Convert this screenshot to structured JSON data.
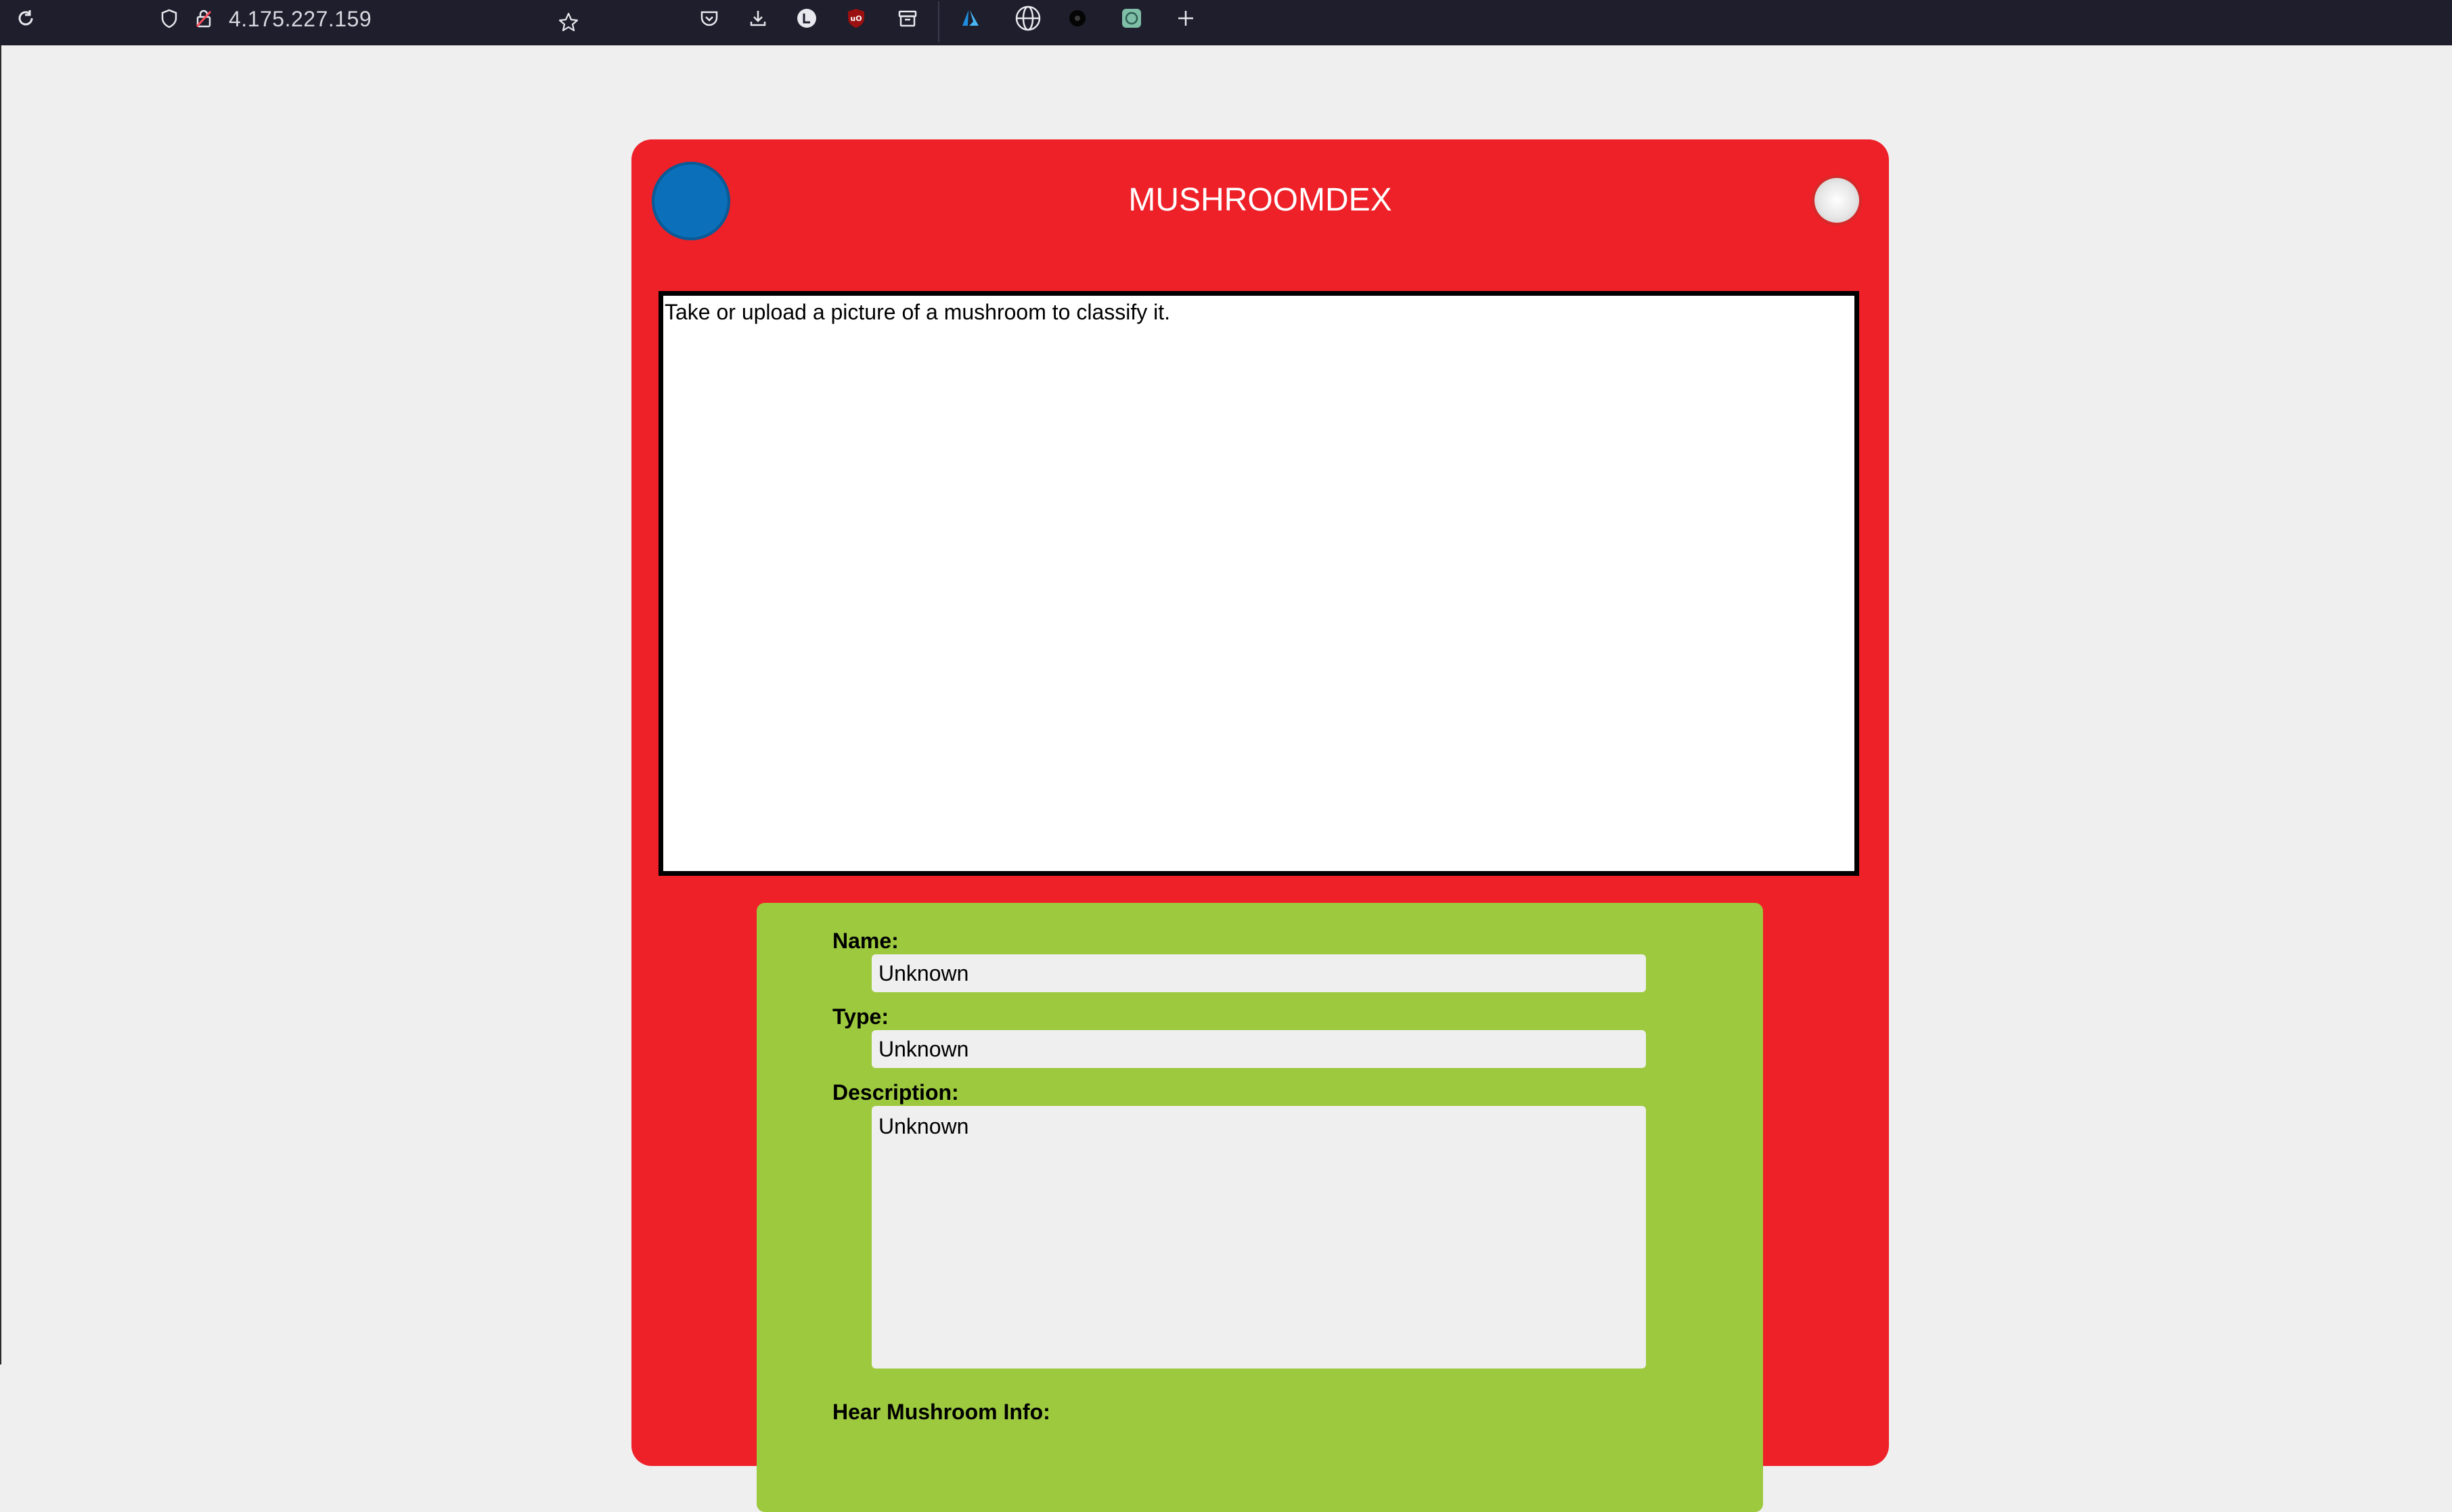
{
  "browser": {
    "url": "4.175.227.159",
    "icons": [
      "reload-icon",
      "shield-icon",
      "lock-icon",
      "star-icon",
      "pocket-icon",
      "download-icon",
      "extension-l-icon",
      "ublock-icon",
      "container-icon",
      "azure-icon",
      "globe-icon",
      "extension-dark-icon",
      "extension-green-icon",
      "new-tab-icon"
    ]
  },
  "app": {
    "title": "MUSHROOMDEX",
    "screen_prompt": "Take or upload a picture of a mushroom to classify it.",
    "fields": {
      "name_label": "Name:",
      "name_value": "Unknown",
      "type_label": "Type:",
      "type_value": "Unknown",
      "description_label": "Description:",
      "description_value": "Unknown",
      "hear_label": "Hear Mushroom Info:"
    },
    "colors": {
      "device": "#ee2028",
      "lens": "#0b6fb9",
      "panel": "#9cc93e",
      "screen": "#ffffff"
    }
  }
}
